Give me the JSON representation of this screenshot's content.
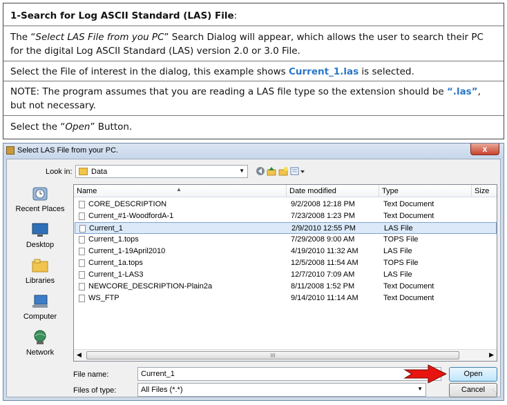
{
  "instructions": {
    "heading": "1-Search for Log ASCII Standard (LAS) File",
    "heading_suffix": ":",
    "p1_a": "The “",
    "p1_em": "Select LAS File from you PC",
    "p1_b": "” Search Dialog will appear, which allows the user to search their PC",
    "p1_line2": "for the digital Log ASCII Standard (LAS) version 2.0 or 3.0 File.",
    "p2_a": "Select the File of interest in the dialog, this example shows ",
    "p2_file": "Current_1.las",
    "p2_b": " is selected.",
    "p3_a": "NOTE: The program assumes that you are reading a LAS file type so the extension should be ",
    "p3_ext": "“.las”",
    "p3_b": ",",
    "p3_line2": "but not necessary.",
    "p4_a": "Select the “",
    "p4_em": "Open",
    "p4_b": "” Button."
  },
  "dialog": {
    "title": "Select LAS File from your PC.",
    "close_label": "x",
    "look_in_label": "Look in:",
    "look_in_value": "Data",
    "places": [
      "Recent Places",
      "Desktop",
      "Libraries",
      "Computer",
      "Network"
    ],
    "columns": [
      "Name",
      "Date modified",
      "Type",
      "Size"
    ],
    "files": [
      {
        "name": "CORE_DESCRIPTION",
        "date": "9/2/2008 12:18 PM",
        "type": "Text Document"
      },
      {
        "name": "Current_#1-WoodfordA-1",
        "date": "7/23/2008 1:23 PM",
        "type": "Text Document"
      },
      {
        "name": "Current_1",
        "date": "2/9/2010 12:55 PM",
        "type": "LAS File"
      },
      {
        "name": "Current_1.tops",
        "date": "7/29/2008 9:00 AM",
        "type": "TOPS File"
      },
      {
        "name": "Current_1-19April2010",
        "date": "4/19/2010 11:32 AM",
        "type": "LAS File"
      },
      {
        "name": "Current_1a.tops",
        "date": "12/5/2008 11:54 AM",
        "type": "TOPS File"
      },
      {
        "name": "Current_1-LAS3",
        "date": "12/7/2010 7:09 AM",
        "type": "LAS File"
      },
      {
        "name": "NEWCORE_DESCRIPTION-Plain2a",
        "date": "8/11/2008 1:52 PM",
        "type": "Text Document"
      },
      {
        "name": "WS_FTP",
        "date": "9/14/2010 11:14 AM",
        "type": "Text Document"
      }
    ],
    "selected_index": 2,
    "scroll_grip": "III",
    "file_name_label": "File name:",
    "file_name_value": "Current_1",
    "files_of_type_label": "Files of type:",
    "files_of_type_value": "All Files (*.*)",
    "open_label": "Open",
    "cancel_label": "Cancel",
    "accent_colors": {
      "highlight_text": "#2a76c6",
      "arrow": "#e8140f",
      "selection": "#dbe9f8"
    }
  }
}
